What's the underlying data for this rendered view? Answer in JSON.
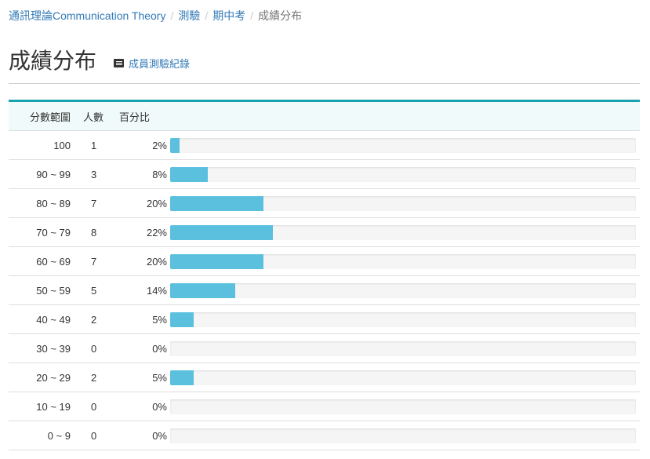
{
  "breadcrumb": {
    "course": "通訊理論Communication Theory",
    "quiz": "測驗",
    "exam": "期中考",
    "current": "成績分布"
  },
  "page": {
    "title": "成績分布",
    "member_link": "成員測驗紀錄"
  },
  "table": {
    "headers": [
      "分數範圍",
      "人數",
      "百分比"
    ],
    "rows": [
      {
        "range": "100",
        "count": "1",
        "percent": "2%"
      },
      {
        "range": "90 ~ 99",
        "count": "3",
        "percent": "8%"
      },
      {
        "range": "80 ~ 89",
        "count": "7",
        "percent": "20%"
      },
      {
        "range": "70 ~ 79",
        "count": "8",
        "percent": "22%"
      },
      {
        "range": "60 ~ 69",
        "count": "7",
        "percent": "20%"
      },
      {
        "range": "50 ~ 59",
        "count": "5",
        "percent": "14%"
      },
      {
        "range": "40 ~ 49",
        "count": "2",
        "percent": "5%"
      },
      {
        "range": "30 ~ 39",
        "count": "0",
        "percent": "0%"
      },
      {
        "range": "20 ~ 29",
        "count": "2",
        "percent": "5%"
      },
      {
        "range": "10 ~ 19",
        "count": "0",
        "percent": "0%"
      },
      {
        "range": "0 ~ 9",
        "count": "0",
        "percent": "0%"
      }
    ]
  },
  "colors": {
    "accent": "#17a2ad",
    "bar": "#5bc0de",
    "link": "#337ab7"
  }
}
